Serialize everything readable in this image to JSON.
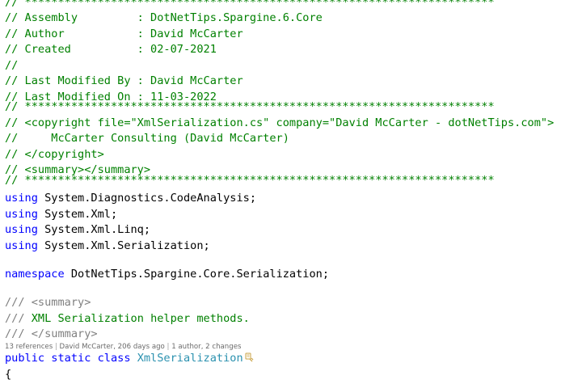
{
  "editor": {
    "lines": [
      "// ***********************************************************************",
      "// Assembly         : DotNetTips.Spargine.6.Core",
      "// Author           : David McCarter",
      "// Created          : 02-07-2021",
      "//",
      "// Last Modified By : David McCarter",
      "// Last Modified On : 11-03-2022",
      "// ***********************************************************************",
      "// <copyright file=\"XmlSerialization.cs\" company=\"David McCarter - dotNetTips.com\">",
      "//     McCarter Consulting (David McCarter)",
      "// </copyright>",
      "// <summary></summary>",
      "// ***********************************************************************"
    ],
    "usings": [
      {
        "keyword": "using",
        "ns": " System.Diagnostics.CodeAnalysis;"
      },
      {
        "keyword": "using",
        "ns": " System.Xml;"
      },
      {
        "keyword": "using",
        "ns": " System.Xml.Linq;"
      },
      {
        "keyword": "using",
        "ns": " System.Xml.Serialization;"
      }
    ],
    "namespace_decl": {
      "keyword": "namespace",
      "name": " DotNetTips.Spargine.Core.Serialization;"
    },
    "doc_comment": {
      "open_prefix": "/// ",
      "open_tag": "<summary>",
      "text_prefix": "/// ",
      "text": "XML Serialization helper methods.",
      "close_prefix": "/// ",
      "close_tag": "</summary>"
    },
    "codelens": {
      "references": "13 references",
      "separator": " | ",
      "last_change": "David McCarter, 206 days ago",
      "authors": "1 author, 2 changes"
    },
    "class_decl": {
      "modifiers": "public static class ",
      "name": "XmlSerialization"
    },
    "open_brace": "{"
  },
  "colors": {
    "comment": "#008000",
    "keyword": "#0000ff",
    "type": "#2b91af",
    "doc_tag": "#808080",
    "text": "#000000",
    "background": "#ffffff"
  },
  "icons": {
    "quick_action": "lightbulb-screwdriver-icon"
  }
}
